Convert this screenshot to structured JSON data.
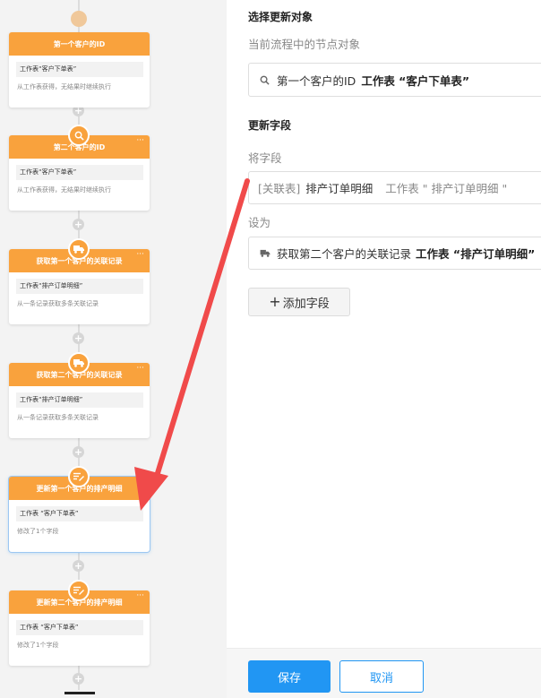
{
  "flow": {
    "nodes": [
      {
        "title": "第一个客户的ID",
        "icon": "search-icon",
        "box": "工作表“客户下单表”",
        "desc": "从工作表获得，无结果时继续执行",
        "more": ""
      },
      {
        "title": "第二个客户的ID",
        "icon": "search-icon",
        "box": "工作表“客户下单表”",
        "desc": "从工作表获得，无结果时继续执行",
        "more": "···"
      },
      {
        "title": "获取第一个客户的关联记录",
        "icon": "truck-icon",
        "box": "工作表“排产订单明细”",
        "desc": "从一条记录获取多条关联记录",
        "more": "···"
      },
      {
        "title": "获取第二个客户的关联记录",
        "icon": "truck-icon",
        "box": "工作表“排产订单明细”",
        "desc": "从一条记录获取多条关联记录",
        "more": "···"
      },
      {
        "title": "更新第一个客户的排产明细",
        "icon": "edit-list-icon",
        "box": "工作表 “客户下单表”",
        "desc": "修改了1个字段",
        "more": ""
      },
      {
        "title": "更新第二个客户的排产明细",
        "icon": "edit-list-icon",
        "box": "工作表 “客户下单表”",
        "desc": "修改了1个字段",
        "more": "···"
      }
    ],
    "plus_symbol": "+"
  },
  "panel": {
    "select_title": "选择更新对象",
    "select_label": "当前流程中的节点对象",
    "select_value_name": "第一个客户的ID",
    "select_value_table": "工作表 “客户下单表”",
    "update_title": "更新字段",
    "field_label": "将字段",
    "field_tag": "[关联表]",
    "field_name": "排产订单明细",
    "field_table": "工作表 \" 排产订单明细 \"",
    "set_label": "设为",
    "set_value_name": "获取第二个客户的关联记录",
    "set_value_table": "工作表 “排产订单明细”",
    "add_field_label": "添加字段",
    "add_symbol": "+"
  },
  "footer": {
    "save_label": "保存",
    "cancel_label": "取消"
  },
  "colors": {
    "node_orange": "#f9a23d",
    "primary_blue": "#2196f3",
    "annotation_red": "#f04a4a"
  }
}
